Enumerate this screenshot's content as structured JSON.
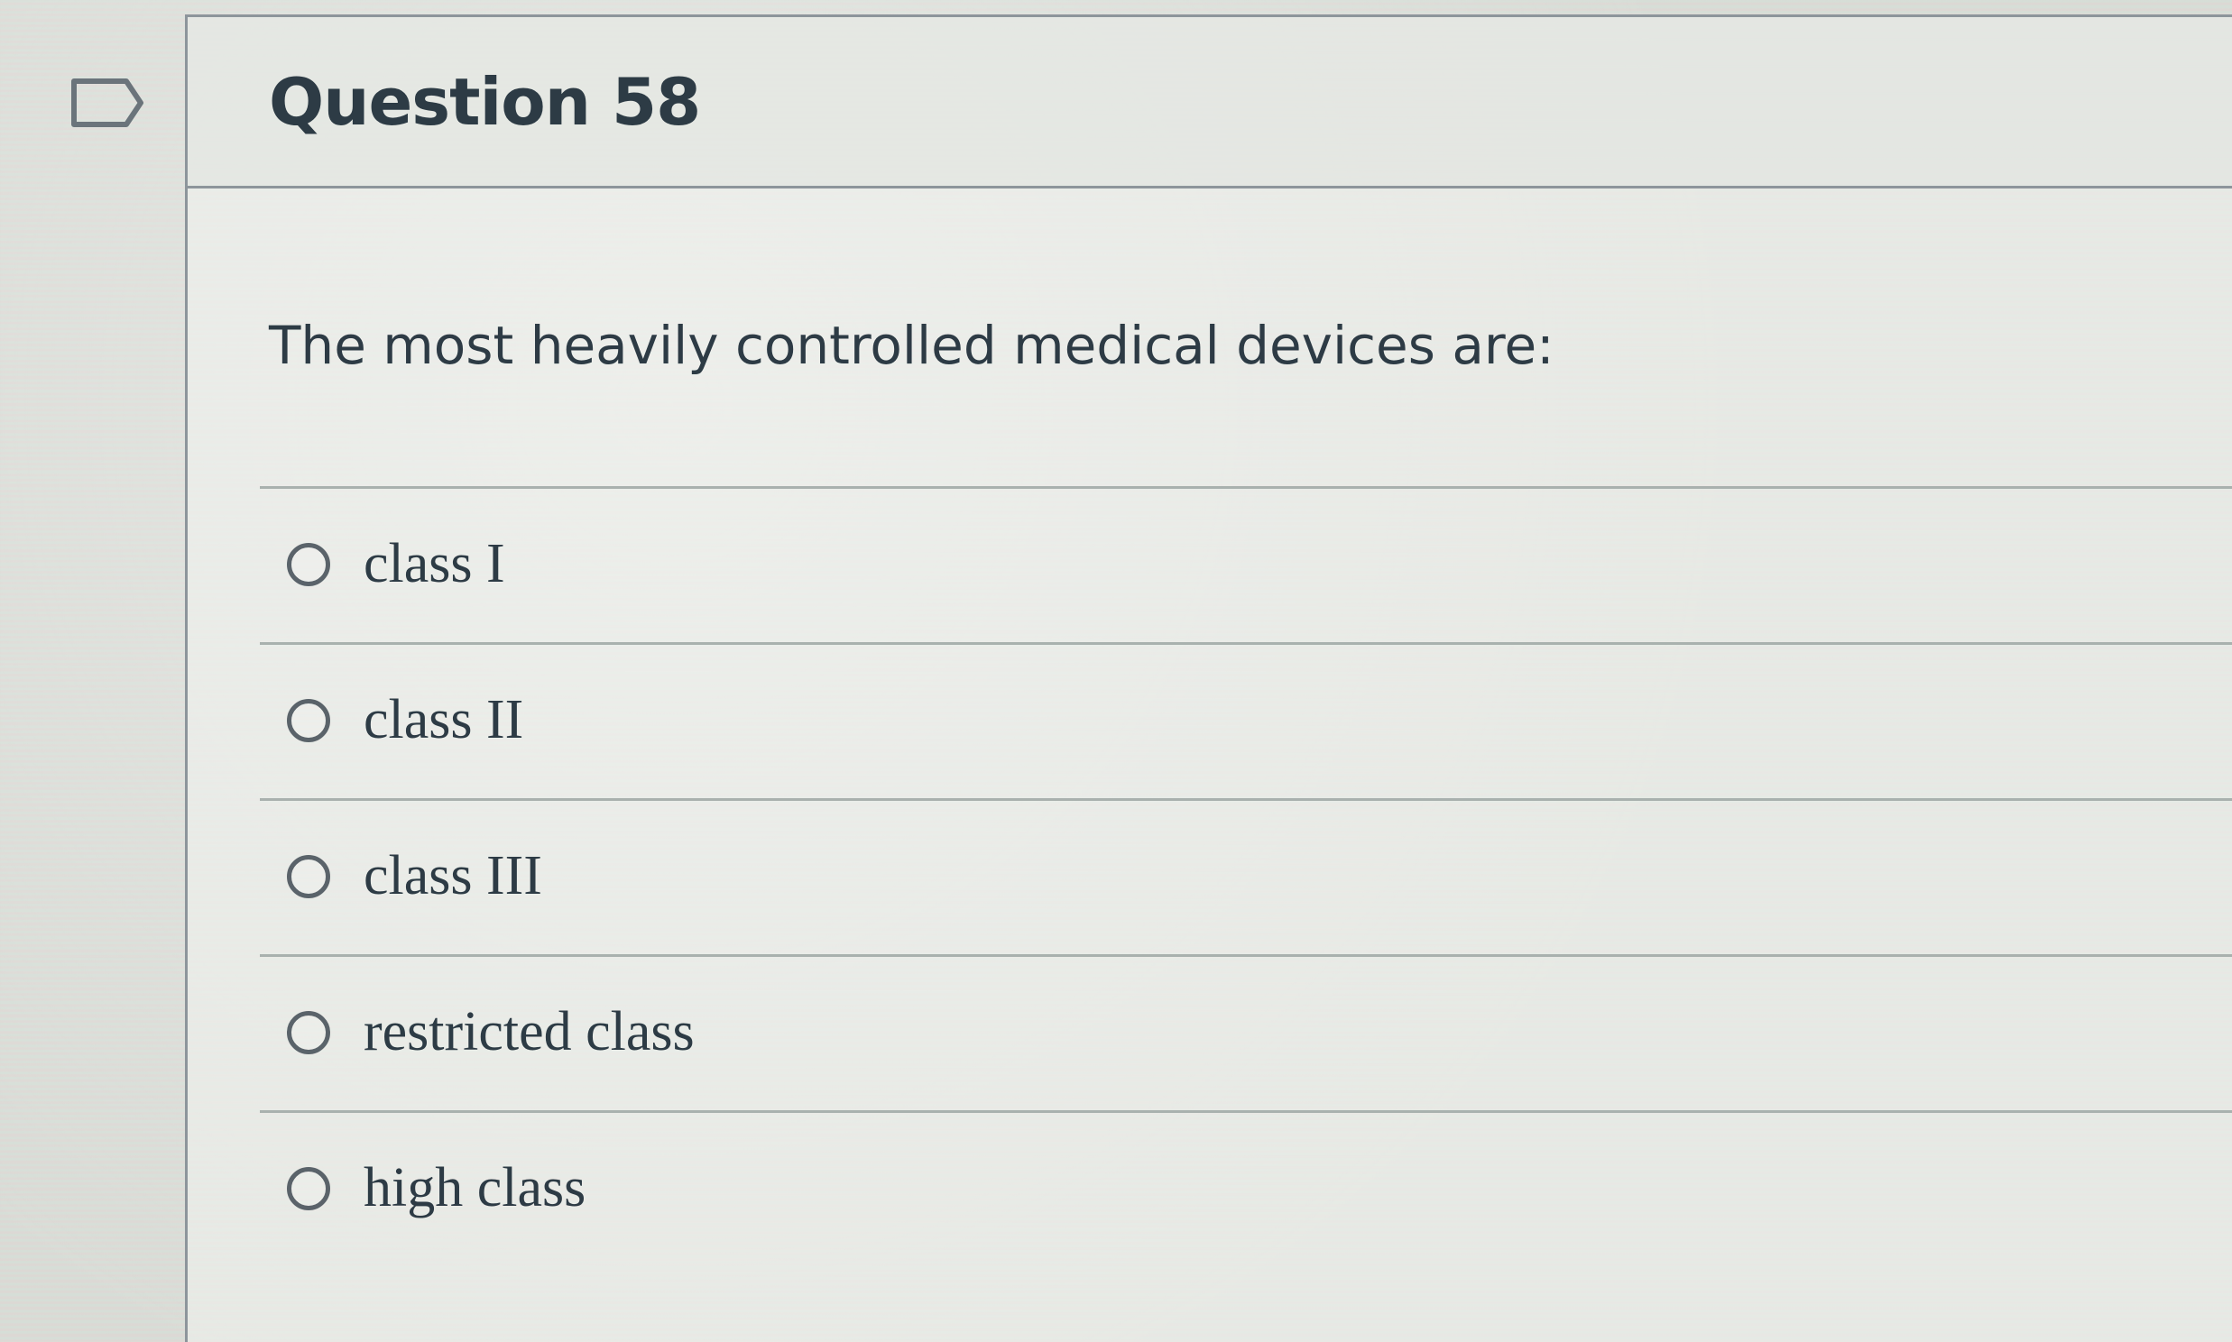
{
  "question": {
    "title": "Question 58",
    "text": "The most heavily controlled medical devices are:",
    "answers": [
      {
        "label": "class I"
      },
      {
        "label": "class II"
      },
      {
        "label": "class III"
      },
      {
        "label": "restricted class"
      },
      {
        "label": "high class"
      }
    ]
  },
  "icons": {
    "flag": "bookmark-flag-icon",
    "radio": "radio-unselected-icon"
  },
  "colors": {
    "text": "#2d3b45",
    "border": "#8d959b",
    "radio": "#5a636a"
  }
}
